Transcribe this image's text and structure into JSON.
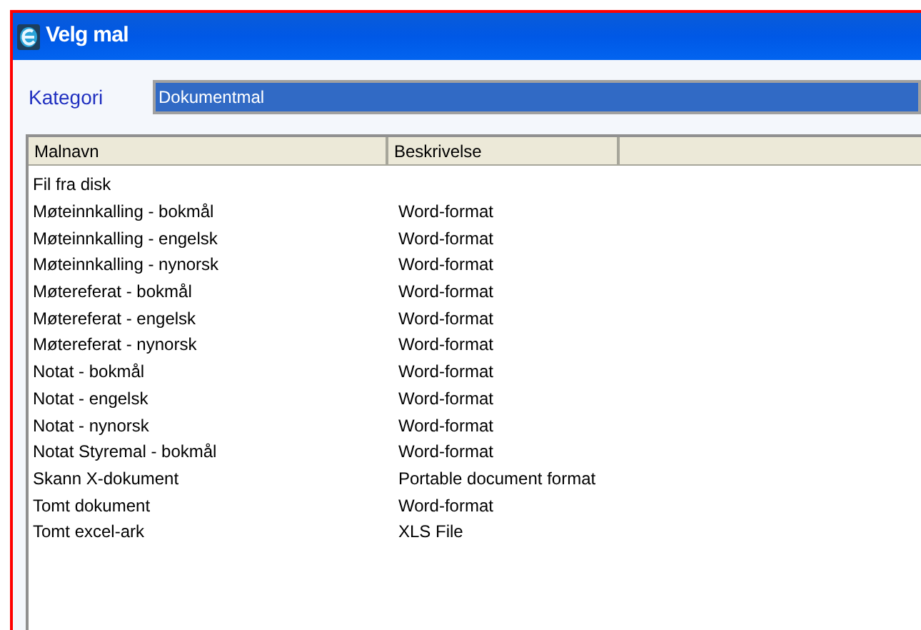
{
  "window": {
    "title": "Velg mal"
  },
  "category": {
    "label": "Kategori",
    "value": "Dokumentmal",
    "selected": true
  },
  "table": {
    "columns": [
      "Malnavn",
      "Beskrivelse"
    ],
    "rows": [
      {
        "name": "Fil fra disk",
        "description": ""
      },
      {
        "name": "Møteinnkalling - bokmål",
        "description": "Word-format"
      },
      {
        "name": "Møteinnkalling - engelsk",
        "description": "Word-format"
      },
      {
        "name": "Møteinnkalling - nynorsk",
        "description": "Word-format"
      },
      {
        "name": "Møtereferat - bokmål",
        "description": "Word-format"
      },
      {
        "name": "Møtereferat - engelsk",
        "description": "Word-format"
      },
      {
        "name": "Møtereferat - nynorsk",
        "description": "Word-format"
      },
      {
        "name": "Notat - bokmål",
        "description": "Word-format"
      },
      {
        "name": "Notat - engelsk",
        "description": "Word-format"
      },
      {
        "name": "Notat - nynorsk",
        "description": "Word-format"
      },
      {
        "name": "Notat Styremal - bokmål",
        "description": "Word-format"
      },
      {
        "name": "Skann X-dokument",
        "description": "Portable document format"
      },
      {
        "name": "Tomt dokument",
        "description": "Word-format"
      },
      {
        "name": "Tomt excel-ark",
        "description": "XLS File"
      }
    ]
  }
}
